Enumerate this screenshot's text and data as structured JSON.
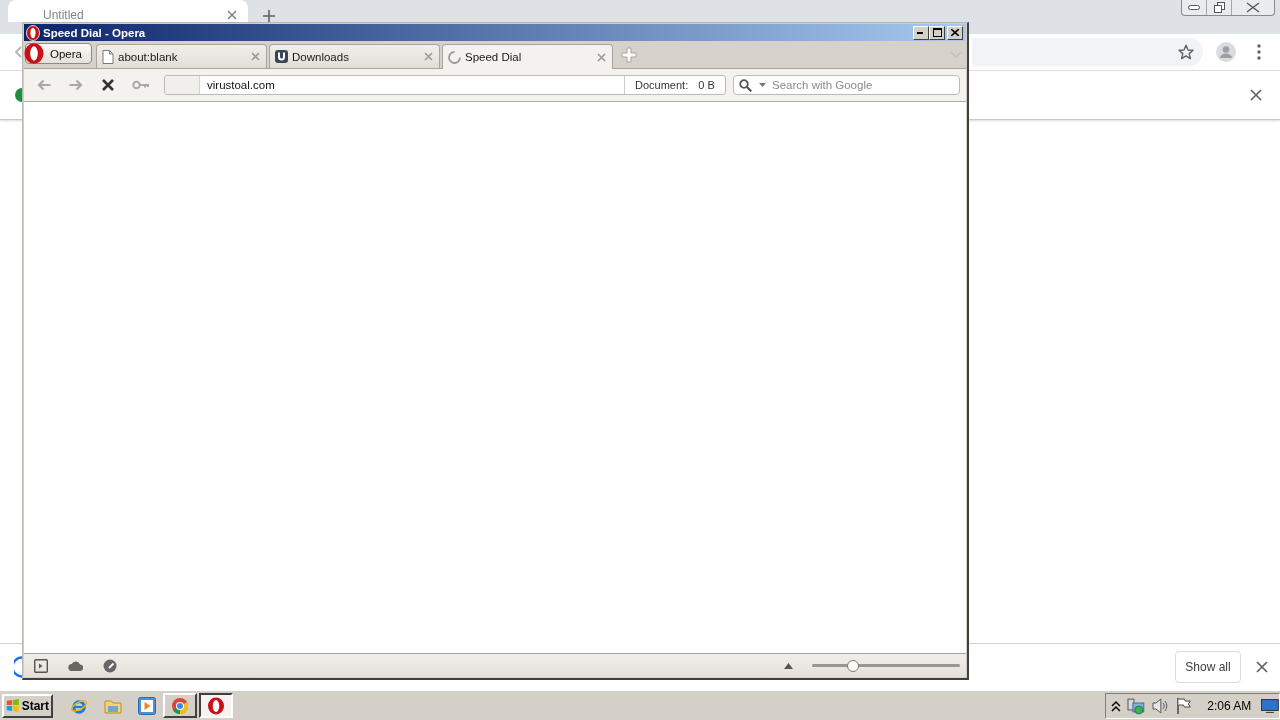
{
  "background_window": {
    "tab": {
      "title": "Untitled"
    },
    "download_bar": {
      "button": "Show all"
    }
  },
  "window": {
    "title": "Speed Dial - Opera"
  },
  "menu_button": {
    "label": "Opera"
  },
  "tabs": [
    {
      "title": "about:blank",
      "kind": "page",
      "selected": false
    },
    {
      "title": "Downloads",
      "kind": "downloads",
      "selected": false
    },
    {
      "title": "Speed Dial",
      "kind": "loading",
      "selected": true
    }
  ],
  "toolbar": {
    "buttons": [
      {
        "kind": "back",
        "disabled": true
      },
      {
        "kind": "forward",
        "disabled": true
      },
      {
        "kind": "stop",
        "disabled": false
      },
      {
        "kind": "key",
        "disabled": true
      }
    ],
    "address": {
      "value": "virustoal.com"
    },
    "document": {
      "label": "Document:",
      "size": "0 B"
    },
    "search": {
      "placeholder": "Search with Google"
    }
  },
  "status_bar": {
    "zoom": {
      "level": 0.28
    }
  },
  "taskbar": {
    "start": "Start",
    "quick_launch": [
      {
        "kind": "ie"
      },
      {
        "kind": "explorer"
      },
      {
        "kind": "media"
      }
    ],
    "windows": [
      {
        "kind": "chrome",
        "selected": false
      },
      {
        "kind": "opera",
        "selected": true
      }
    ],
    "clock": "2:06 AM"
  }
}
